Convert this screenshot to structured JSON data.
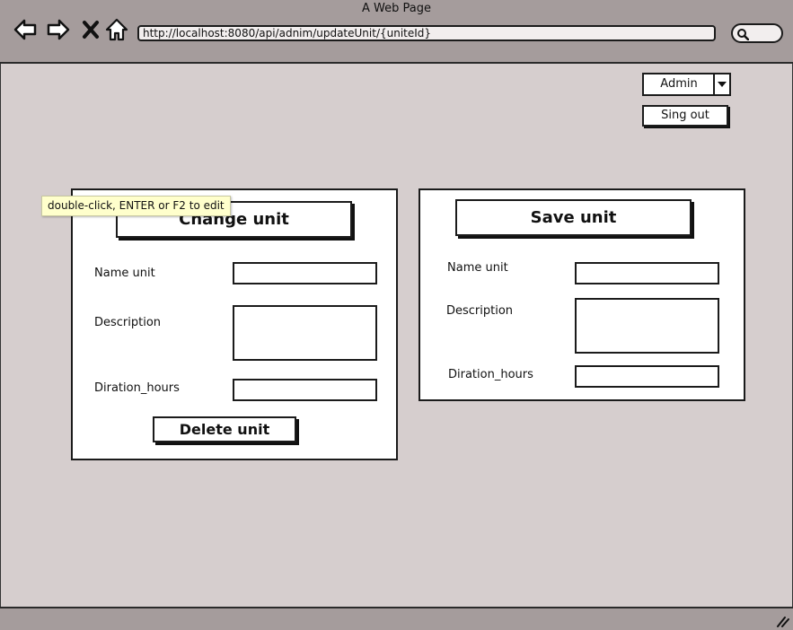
{
  "window": {
    "title": "A Web Page",
    "url": "http://localhost:8080/api/adnim/updateUnit/{uniteId}"
  },
  "nav": {
    "icons": [
      "back-arrow-icon",
      "forward-arrow-icon",
      "close-x-icon",
      "home-icon"
    ]
  },
  "user_menu": {
    "selected": "Admin",
    "sign_out_label": "Sing out"
  },
  "tooltip": {
    "text": "double-click, ENTER or F2 to edit"
  },
  "change_panel": {
    "title_button": "Change unit",
    "fields": [
      {
        "label": "Name unit",
        "value": ""
      },
      {
        "label": "Description",
        "value": ""
      },
      {
        "label": "Diration_hours",
        "value": ""
      }
    ],
    "delete_button": "Delete unit"
  },
  "save_panel": {
    "title_button": "Save unit",
    "fields": [
      {
        "label": "Name unit",
        "value": ""
      },
      {
        "label": "Description",
        "value": ""
      },
      {
        "label": "Diration_hours",
        "value": ""
      }
    ]
  },
  "colors": {
    "chrome": "#a59c9c",
    "canvas": "#d6cece",
    "panel": "#ffffff",
    "tooltip": "#ffffcc"
  }
}
